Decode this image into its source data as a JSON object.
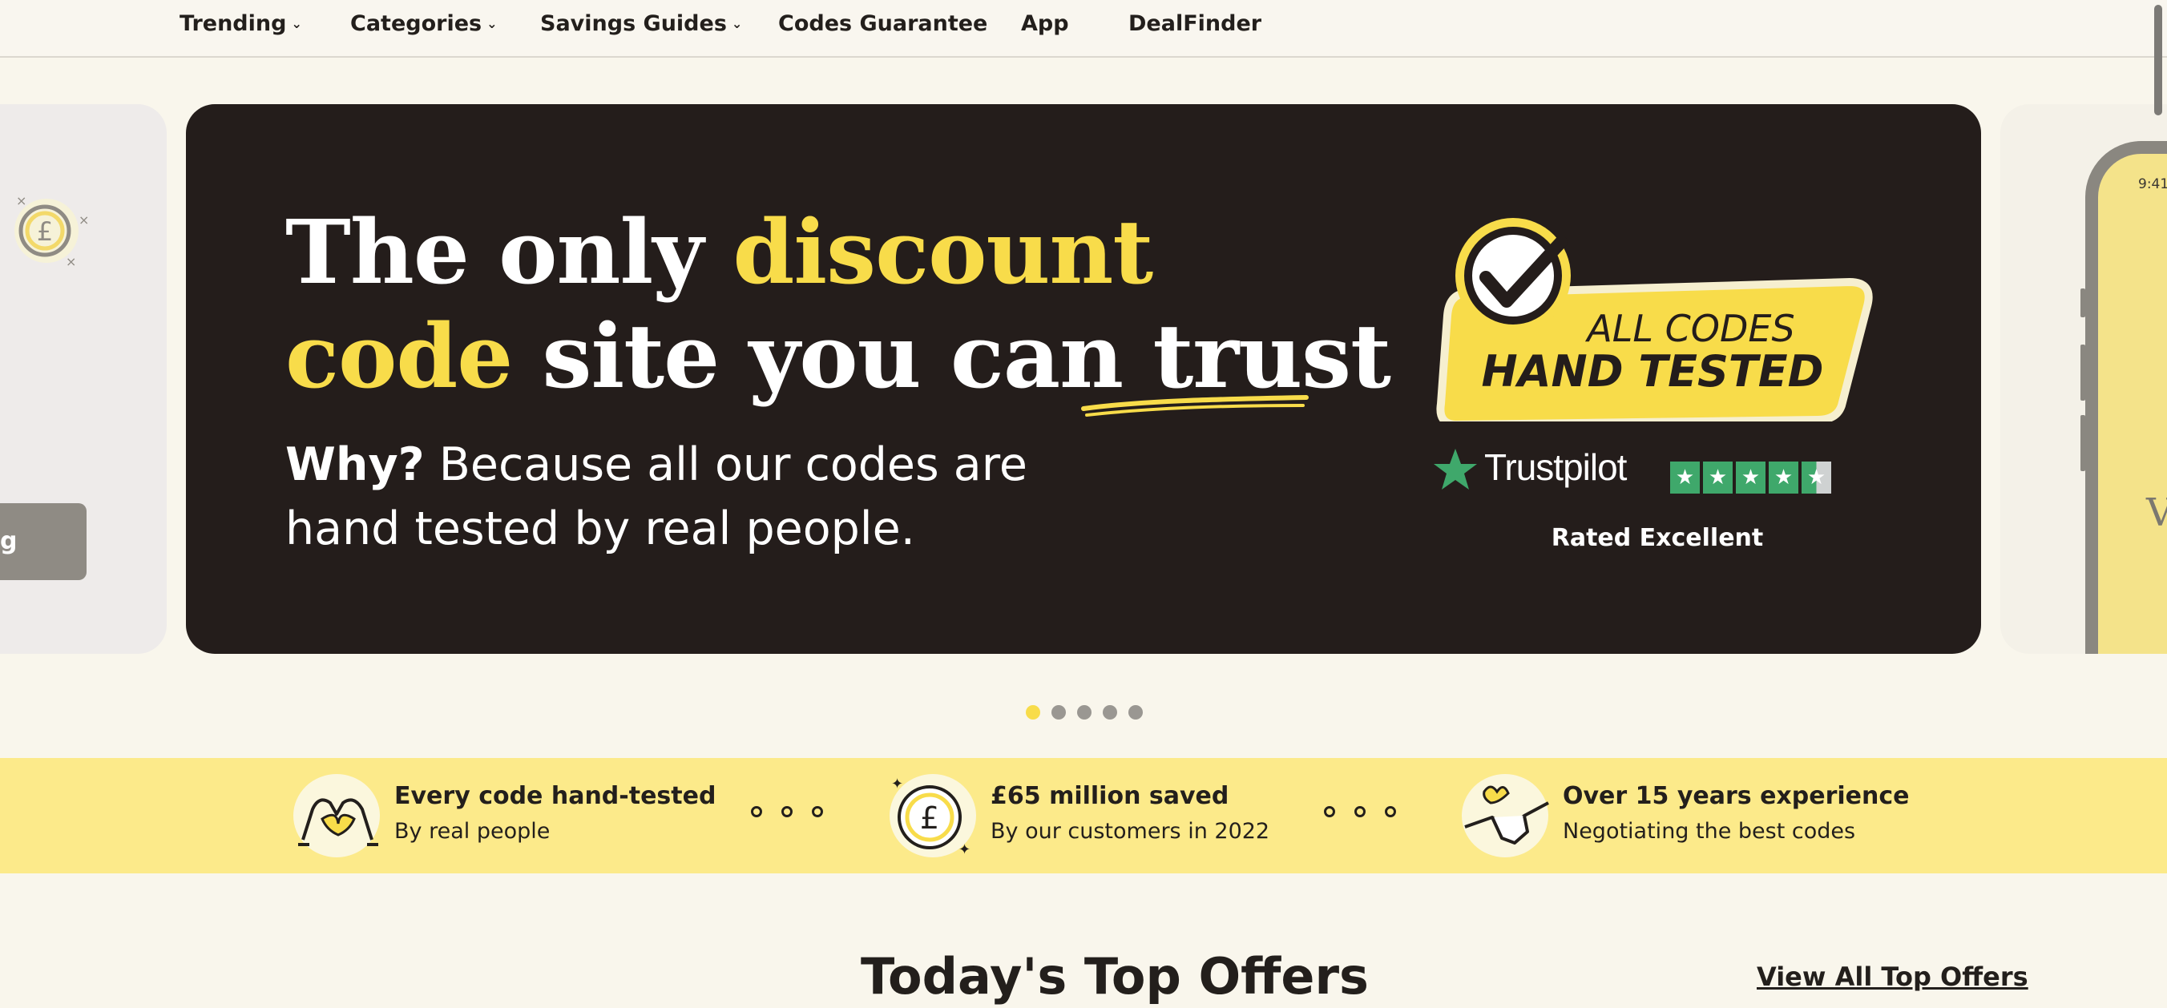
{
  "nav": {
    "items": [
      {
        "label": "Trending",
        "dropdown": true
      },
      {
        "label": "Categories",
        "dropdown": true
      },
      {
        "label": "Savings Guides",
        "dropdown": true
      },
      {
        "label": "Codes Guarantee",
        "dropdown": false
      },
      {
        "label": "App",
        "dropdown": false
      },
      {
        "label": "DealFinder",
        "dropdown": false
      }
    ]
  },
  "carousel": {
    "prev_slide": {
      "button_label": "g"
    },
    "hero": {
      "title_line1_a": "The only ",
      "title_line1_b": "discount",
      "title_line2_a": "code",
      "title_line2_b": " site you can ",
      "title_line2_c": "trust",
      "subtitle_bold": "Why?",
      "subtitle_line1": " Because all our codes are",
      "subtitle_line2": "hand tested by real people.",
      "badge_line1": "ALL CODES",
      "badge_line2": "HAND TESTED",
      "trustpilot_name": "Trustpilot",
      "trustpilot_stars": 4.5,
      "trustpilot_rating": "Rated Excellent"
    },
    "next_slide": {
      "phone_time": "9:41",
      "phone_text": "V"
    },
    "slide_count": 5,
    "active_slide": 1
  },
  "features": [
    {
      "title": "Every code hand-tested",
      "desc": "By real people",
      "icon": "heart-hands-icon"
    },
    {
      "title": "£65 million saved",
      "desc": "By our customers in 2022",
      "icon": "pound-coin-icon"
    },
    {
      "title": "Over 15 years experience",
      "desc": "Negotiating the best codes",
      "icon": "handshake-icon"
    }
  ],
  "top_offers": {
    "title": "Today's Top Offers",
    "view_all": "View All Top Offers"
  },
  "colors": {
    "accent_yellow": "#f8dc4a",
    "hero_bg": "#241d1b",
    "page_bg": "#f9f6ec",
    "strip_bg": "#fcea8a",
    "trustpilot_green": "#3fa86b"
  }
}
